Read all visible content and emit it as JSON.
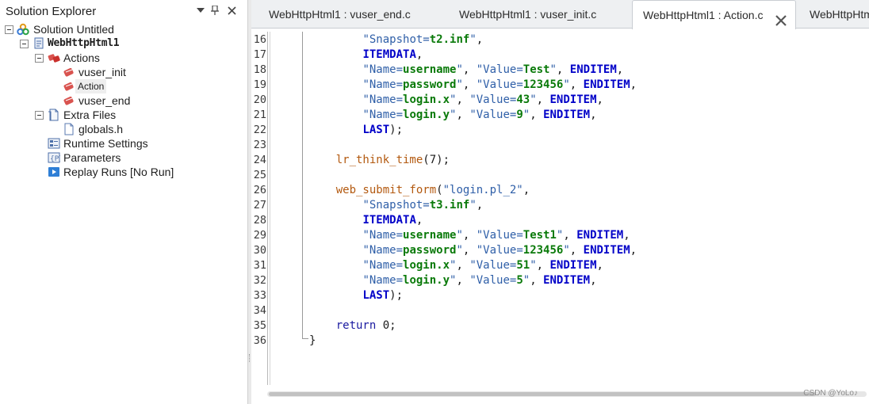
{
  "explorer": {
    "title": "Solution Explorer",
    "tree": {
      "solution": "Solution Untitled",
      "project": "WebHttpHtml1",
      "actions": "Actions",
      "action_items": [
        "vuser_init",
        "Action",
        "vuser_end"
      ],
      "extra_files": "Extra Files",
      "extra_items": [
        "globals.h"
      ],
      "runtime_settings": "Runtime Settings",
      "parameters": "Parameters",
      "replay_runs": "Replay Runs [No Run]"
    }
  },
  "editor": {
    "tabs": [
      {
        "label": "WebHttpHtml1 : vuser_end.c",
        "active": false
      },
      {
        "label": "WebHttpHtml1 : vuser_init.c",
        "active": false
      },
      {
        "label": "WebHttpHtml1 : Action.c",
        "active": true
      },
      {
        "label": "WebHttpHtm",
        "active": false
      }
    ],
    "line_numbers": [
      "16",
      "17",
      "18",
      "19",
      "20",
      "21",
      "22",
      "23",
      "24",
      "25",
      "26",
      "27",
      "28",
      "29",
      "30",
      "31",
      "32",
      "33",
      "34",
      "35",
      "36"
    ],
    "code_lines": [
      "        \"Snapshot=t2.inf\",",
      "        ITEMDATA,",
      "        \"Name=username\", \"Value=Test\", ENDITEM,",
      "        \"Name=password\", \"Value=123456\", ENDITEM,",
      "        \"Name=login.x\", \"Value=43\", ENDITEM,",
      "        \"Name=login.y\", \"Value=9\", ENDITEM,",
      "        LAST);",
      "",
      "    lr_think_time(7);",
      "",
      "    web_submit_form(\"login.pl_2\",",
      "        \"Snapshot=t3.inf\",",
      "        ITEMDATA,",
      "        \"Name=username\", \"Value=Test1\", ENDITEM,",
      "        \"Name=password\", \"Value=123456\", ENDITEM,",
      "        \"Name=login.x\", \"Value=51\", ENDITEM,",
      "        \"Name=login.y\", \"Value=5\", ENDITEM,",
      "        LAST);",
      "",
      "    return 0;",
      "}"
    ],
    "watermark": "CSDN @YoLo♪"
  },
  "colors": {
    "keyword": "#0000c8",
    "string": "#2f5fa8",
    "value": "#0a7a0a",
    "function": "#b3590f"
  },
  "icons": [
    "solution-icon",
    "project-icon",
    "actions-icon",
    "action-file-icon",
    "folder-icon",
    "file-icon",
    "settings-icon",
    "parameters-icon",
    "replay-icon",
    "dropdown-icon",
    "pin-icon",
    "close-icon"
  ]
}
